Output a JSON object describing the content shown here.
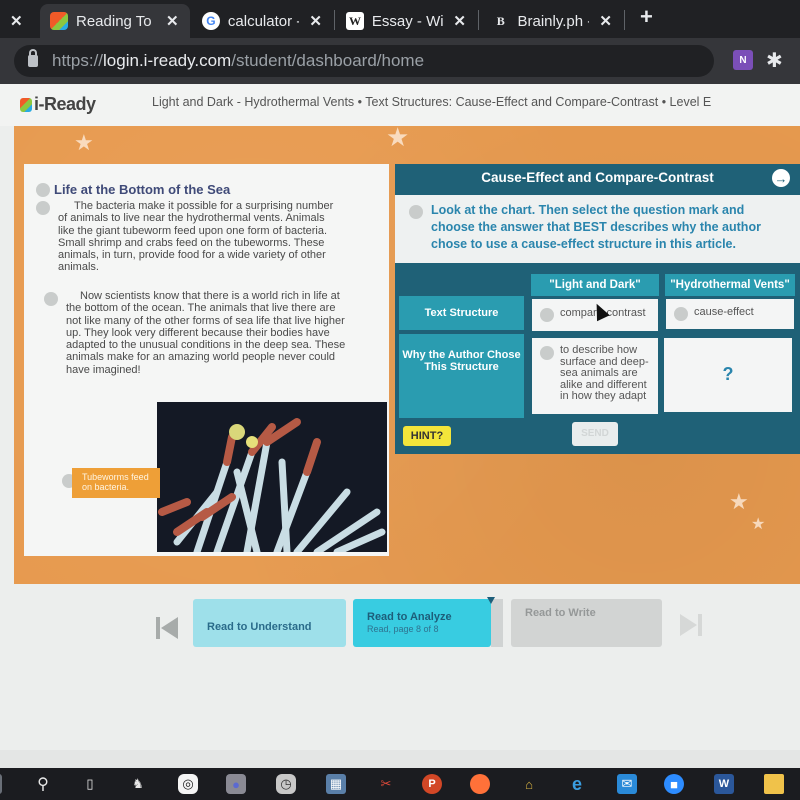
{
  "browser": {
    "tabs": [
      {
        "title": "Reading To",
        "favicon": "iready-cube-icon",
        "active": true
      },
      {
        "title": "calculator -",
        "favicon": "google-icon",
        "active": false
      },
      {
        "title": "Essay - Wik",
        "favicon": "wikipedia-icon",
        "active": false
      },
      {
        "title": "Brainly.ph -",
        "favicon": "brainly-icon",
        "active": false
      }
    ],
    "close_glyph": "✕",
    "new_tab_glyph": "+",
    "url": {
      "scheme": "https://",
      "host": "login.i-ready.com",
      "path": "/student/dashboard/home"
    },
    "extensions": [
      {
        "name": "onenote-icon",
        "glyph": "N"
      },
      {
        "name": "puzzle-icon",
        "glyph": "✱"
      }
    ]
  },
  "app": {
    "logo": "i-Ready",
    "breadcrumb": "Light and Dark - Hydrothermal Vents • Text Structures: Cause-Effect and Compare-Contrast • Level E"
  },
  "reading": {
    "title": "Life at the Bottom of the Sea",
    "paragraphs": [
      "The bacteria make it possible for a surprising number of animals to live near the hydrothermal vents. Animals like the giant tubeworm feed upon one form of bacteria. Small shrimp and crabs feed on the tubeworms. These animals, in turn, provide food for a wide variety of other animals.",
      "Now scientists know that there is a world rich in life at the bottom of the ocean. The animals that live there are not like many of the other forms of sea life that live higher up. They look very different because their bodies have adapted to the unusual conditions in the deep sea. These animals make for an amazing world people never could have imagined!"
    ],
    "caption": "Tubeworms feed on bacteria."
  },
  "question": {
    "title": "Cause-Effect and Compare-Contrast",
    "next_glyph": "→",
    "prompt": "Look at the chart. Then select the question mark and choose the answer that BEST describes why the author chose to use a cause-effect structure in this article.",
    "columns": [
      "\"Light and Dark\"",
      "\"Hydrothermal Vents\""
    ],
    "rows": [
      {
        "label": "Text Structure",
        "cells": [
          "compare-contrast",
          "cause-effect"
        ]
      },
      {
        "label": "Why the Author Chose This Structure",
        "cells": [
          "to describe how surface and deep-sea animals are alike and different in how they adapt",
          "?"
        ]
      }
    ],
    "hint_label": "HINT?",
    "send_label": "SEND"
  },
  "nav": {
    "steps": [
      {
        "label": "Read to Understand",
        "sub": "",
        "state": "done"
      },
      {
        "label": "Read to Analyze",
        "sub": "Read, page 8 of 8",
        "state": "current"
      },
      {
        "label": "Read to Write",
        "sub": "",
        "state": "locked"
      }
    ]
  },
  "taskbar": {
    "icons": [
      "start-icon",
      "search-icon",
      "task-view-icon",
      "app-owl-icon",
      "app-glasses-icon",
      "camera-icon",
      "clock-icon",
      "calculator-icon",
      "snipping-tool-icon",
      "powerpoint-icon",
      "firefox-icon",
      "security-icon",
      "edge-icon",
      "mail-icon",
      "zoom-icon",
      "word-icon",
      "file-explorer-icon"
    ]
  }
}
